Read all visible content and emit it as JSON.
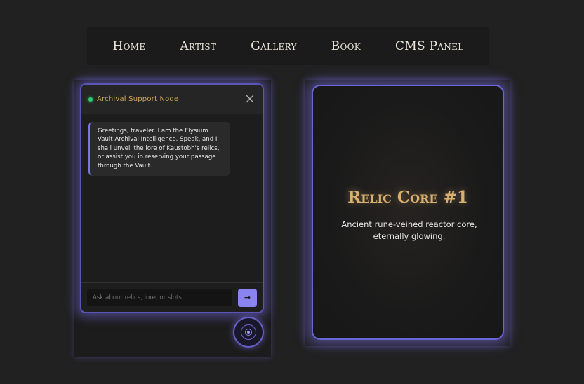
{
  "nav": {
    "items": [
      {
        "label": "Home"
      },
      {
        "label": "Artist"
      },
      {
        "label": "Gallery"
      },
      {
        "label": "Book"
      },
      {
        "label": "CMS Panel"
      }
    ]
  },
  "chat": {
    "title": "Archival Support Node",
    "close_icon": "close-icon",
    "status_color": "#2ecc71",
    "greeting": "Greetings, traveler. I am the Elysium Vault Archival Intelligence. Speak, and I shall unveil the lore of Kaustobh's relics, or assist you in reserving your passage through the Vault.",
    "input_placeholder": "Ask about relics, lore, or slots...",
    "input_value": "",
    "send_label": "→"
  },
  "card": {
    "title": "Relic Core #1",
    "description": "Ancient rune-veined reactor core, eternally glowing."
  },
  "colors": {
    "accent": "#7b75e0",
    "gold": "#d9b06e",
    "background": "#212121"
  }
}
